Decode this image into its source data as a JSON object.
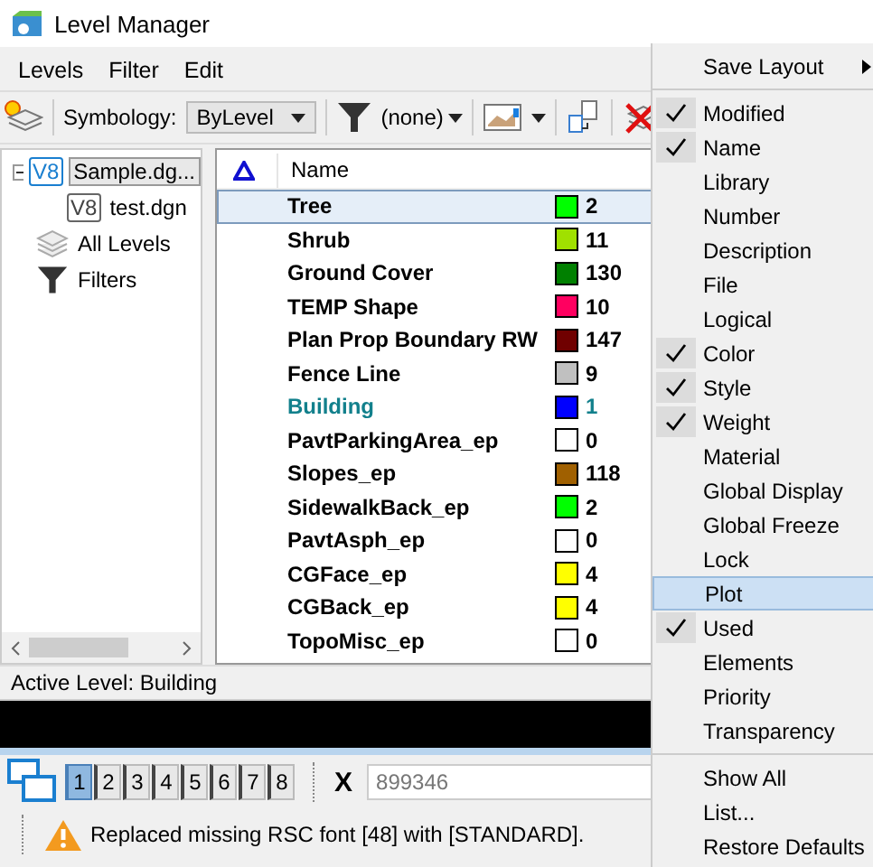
{
  "window": {
    "title": "Level Manager"
  },
  "menu_bar": [
    "Levels",
    "Filter",
    "Edit"
  ],
  "toolbar": {
    "symbology_label": "Symbology:",
    "symbology_value": "ByLevel",
    "filter_value": "(none)"
  },
  "tree": [
    {
      "label": "Sample.dg...",
      "badge": "V8",
      "selected": true,
      "children": [
        {
          "label": "test.dgn",
          "badge": "V8",
          "selected": false
        }
      ]
    },
    {
      "label": "All Levels",
      "selected": false,
      "kind": "levels"
    },
    {
      "label": "Filters",
      "selected": false,
      "kind": "filters"
    }
  ],
  "table": {
    "columns": [
      "Name"
    ],
    "rows": [
      {
        "name": "Tree",
        "color": "#00ff00",
        "number": "2",
        "selected": true,
        "active": false
      },
      {
        "name": "Shrub",
        "color": "#a0e000",
        "number": "11",
        "selected": false,
        "active": false
      },
      {
        "name": "Ground Cover",
        "color": "#008000",
        "number": "130",
        "selected": false,
        "active": false
      },
      {
        "name": "TEMP Shape",
        "color": "#ff0060",
        "number": "10",
        "selected": false,
        "active": false
      },
      {
        "name": "Plan Prop Boundary RW",
        "color": "#700000",
        "number": "147",
        "selected": false,
        "active": false
      },
      {
        "name": "Fence Line",
        "color": "#c0c0c0",
        "number": "9",
        "selected": false,
        "active": false
      },
      {
        "name": "Building",
        "color": "#0000ff",
        "number": "1",
        "selected": false,
        "active": true
      },
      {
        "name": "PavtParkingArea_ep",
        "color": "#ffffff",
        "number": "0",
        "selected": false,
        "active": false
      },
      {
        "name": "Slopes_ep",
        "color": "#a06000",
        "number": "118",
        "selected": false,
        "active": false
      },
      {
        "name": "SidewalkBack_ep",
        "color": "#00ff00",
        "number": "2",
        "selected": false,
        "active": false
      },
      {
        "name": "PavtAsph_ep",
        "color": "#ffffff",
        "number": "0",
        "selected": false,
        "active": false
      },
      {
        "name": "CGFace_ep",
        "color": "#ffff00",
        "number": "4",
        "selected": false,
        "active": false
      },
      {
        "name": "CGBack_ep",
        "color": "#ffff00",
        "number": "4",
        "selected": false,
        "active": false
      },
      {
        "name": "TopoMisc_ep",
        "color": "#ffffff",
        "number": "0",
        "selected": false,
        "active": false
      }
    ]
  },
  "active_level": "Active Level: Building",
  "views": [
    {
      "label": "1",
      "selected": true
    },
    {
      "label": "2",
      "selected": false
    },
    {
      "label": "3",
      "selected": false
    },
    {
      "label": "4",
      "selected": false
    },
    {
      "label": "5",
      "selected": false
    },
    {
      "label": "6",
      "selected": false
    },
    {
      "label": "7",
      "selected": false
    },
    {
      "label": "8",
      "selected": false
    }
  ],
  "coordinate": {
    "label": "X",
    "value": "899346"
  },
  "status_bar": {
    "message": "Replaced missing RSC font [48] with [STANDARD]."
  },
  "context_menu": [
    {
      "kind": "submenu",
      "label": "Save Layout"
    },
    {
      "kind": "separator"
    },
    {
      "kind": "check",
      "label": "Modified",
      "checked": true,
      "selected": false
    },
    {
      "kind": "check",
      "label": "Name",
      "checked": true,
      "selected": false
    },
    {
      "kind": "check",
      "label": "Library",
      "checked": false,
      "selected": false
    },
    {
      "kind": "check",
      "label": "Number",
      "checked": false,
      "selected": false
    },
    {
      "kind": "check",
      "label": "Description",
      "checked": false,
      "selected": false
    },
    {
      "kind": "check",
      "label": "File",
      "checked": false,
      "selected": false
    },
    {
      "kind": "check",
      "label": "Logical",
      "checked": false,
      "selected": false
    },
    {
      "kind": "check",
      "label": "Color",
      "checked": true,
      "selected": false
    },
    {
      "kind": "check",
      "label": "Style",
      "checked": true,
      "selected": false
    },
    {
      "kind": "check",
      "label": "Weight",
      "checked": true,
      "selected": false
    },
    {
      "kind": "check",
      "label": "Material",
      "checked": false,
      "selected": false
    },
    {
      "kind": "check",
      "label": "Global Display",
      "checked": false,
      "selected": false
    },
    {
      "kind": "check",
      "label": "Global Freeze",
      "checked": false,
      "selected": false
    },
    {
      "kind": "check",
      "label": "Lock",
      "checked": false,
      "selected": false
    },
    {
      "kind": "check",
      "label": "Plot",
      "checked": false,
      "selected": true
    },
    {
      "kind": "check",
      "label": "Used",
      "checked": true,
      "selected": false
    },
    {
      "kind": "check",
      "label": "Elements",
      "checked": false,
      "selected": false
    },
    {
      "kind": "check",
      "label": "Priority",
      "checked": false,
      "selected": false
    },
    {
      "kind": "check",
      "label": "Transparency",
      "checked": false,
      "selected": false
    },
    {
      "kind": "separator"
    },
    {
      "kind": "command",
      "label": "Show All"
    },
    {
      "kind": "command",
      "label": "List..."
    },
    {
      "kind": "command",
      "label": "Restore Defaults"
    }
  ]
}
